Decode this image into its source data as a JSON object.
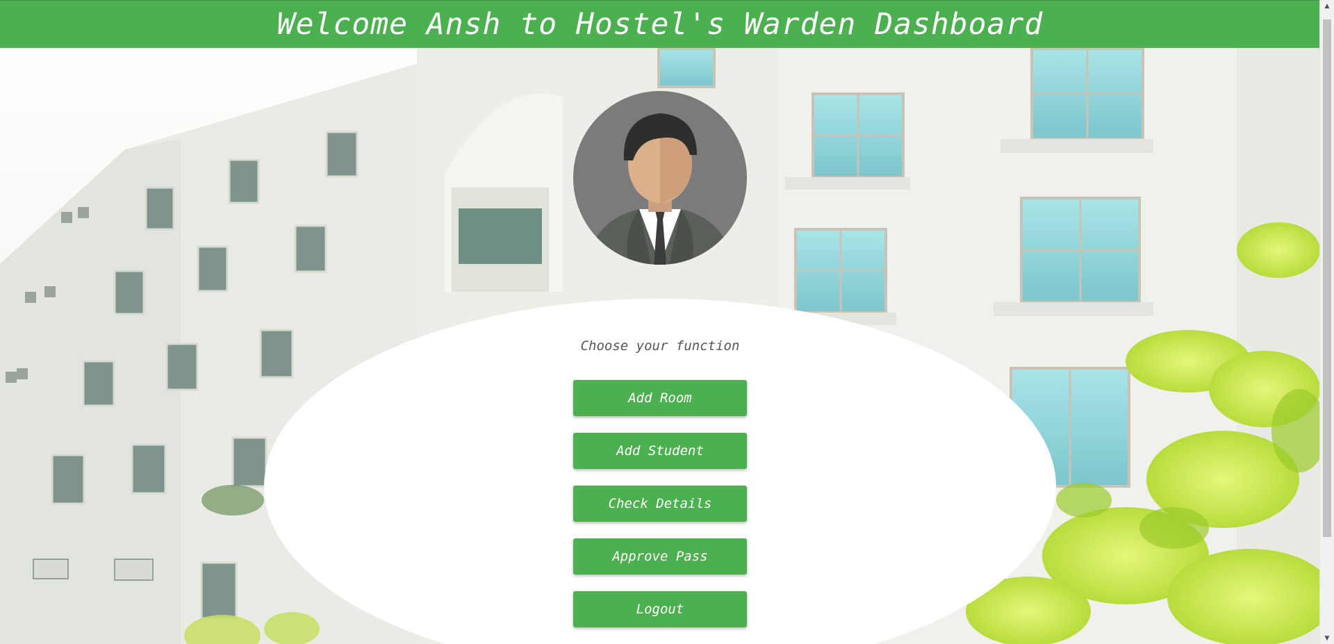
{
  "header": {
    "title": "Welcome Ansh to Hostel's Warden Dashboard"
  },
  "avatar": {
    "icon": "user-avatar-icon"
  },
  "panel": {
    "prompt": "Choose your function",
    "buttons": [
      {
        "label": "Add Room"
      },
      {
        "label": "Add Student"
      },
      {
        "label": "Check Details"
      },
      {
        "label": "Approve Pass"
      },
      {
        "label": "Logout"
      }
    ]
  },
  "colors": {
    "accent": "#4caf50",
    "panel": "#ffffff",
    "header_text": "#ffffff"
  }
}
